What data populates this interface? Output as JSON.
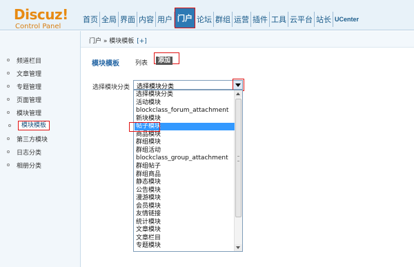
{
  "header": {
    "logo_main": "Discuz!",
    "logo_sub": "Control Panel",
    "nav": [
      "首页",
      "全局",
      "界面",
      "内容",
      "用户",
      "门户",
      "论坛",
      "群组",
      "运营",
      "插件",
      "工具",
      "云平台",
      "站长",
      "UCenter"
    ],
    "active_nav": "门户"
  },
  "sidebar": {
    "items": [
      "频道栏目",
      "文章管理",
      "专题管理",
      "页面管理",
      "模块管理",
      "模块模板",
      "第三方模块",
      "日志分类",
      "相册分类"
    ],
    "active_item": "模块模板"
  },
  "breadcrumb": {
    "text": "门户 » 模块模板",
    "add_link": "[+]"
  },
  "main": {
    "title": "模块模板",
    "tab_list": "列表",
    "tab_add": "添加",
    "field_label": "选择模块分类",
    "select_value": "选择模块分类",
    "options": [
      "选择模块分类",
      "活动模块",
      "blockclass_forum_attachment",
      "新块模块",
      "帖子模块",
      "商品模块",
      "群组模块",
      "群组活动",
      "blockclass_group_attachment",
      "群组帖子",
      "群组商品",
      "静态模块",
      "公告模块",
      "漫游模块",
      "会员模块",
      "友情链接",
      "统计模块",
      "文章模块",
      "文章栏目",
      "专题模块"
    ],
    "selected_option": "帖子模块"
  },
  "colors": {
    "accent": "#2d79b4",
    "highlight_border": "#e01010",
    "selection": "#3399ff",
    "logo": "#e78a12"
  }
}
